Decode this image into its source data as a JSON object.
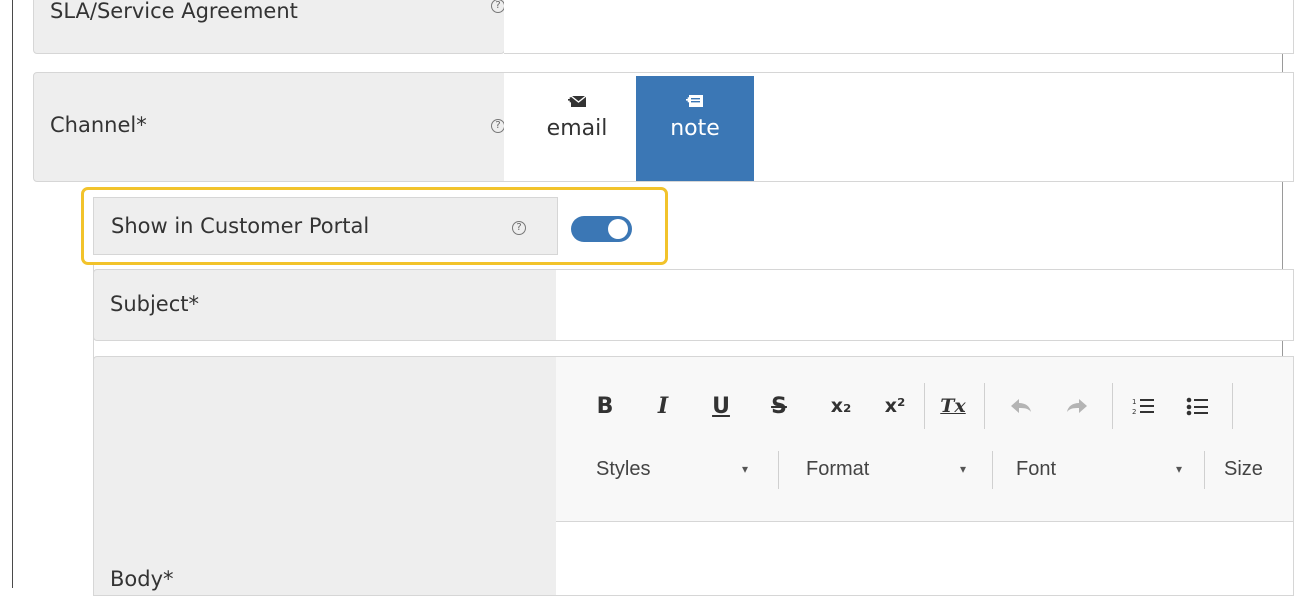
{
  "form": {
    "sla": {
      "label": "SLA/Service Agreement"
    },
    "channel": {
      "label": "Channel*",
      "options": [
        {
          "label": "email",
          "icon": "email-icon",
          "selected": false
        },
        {
          "label": "note",
          "icon": "note-icon",
          "selected": true
        }
      ]
    },
    "portal": {
      "label": "Show in Customer Portal",
      "toggle_on": true
    },
    "subject": {
      "label": "Subject*",
      "value": ""
    },
    "body": {
      "label": "Body*"
    },
    "help_icon": "?"
  },
  "editor": {
    "format_buttons": [
      {
        "name": "bold",
        "glyph": "B"
      },
      {
        "name": "italic",
        "glyph": "I"
      },
      {
        "name": "underline",
        "glyph": "U"
      },
      {
        "name": "strikethrough",
        "glyph": "S"
      },
      {
        "name": "subscript",
        "glyph": "x₂"
      },
      {
        "name": "superscript",
        "glyph": "x²"
      },
      {
        "name": "remove-format",
        "glyph": "Tx"
      }
    ],
    "history_buttons": [
      {
        "name": "undo",
        "enabled": false
      },
      {
        "name": "redo",
        "enabled": false
      }
    ],
    "list_buttons": [
      {
        "name": "numbered-list"
      },
      {
        "name": "bulleted-list"
      }
    ],
    "combos": [
      {
        "label": "Styles"
      },
      {
        "label": "Format"
      },
      {
        "label": "Font"
      },
      {
        "label": "Size"
      }
    ]
  },
  "colors": {
    "accent": "#3b77b5",
    "highlight": "#f2c32b",
    "label_bg": "#eeeeee"
  }
}
